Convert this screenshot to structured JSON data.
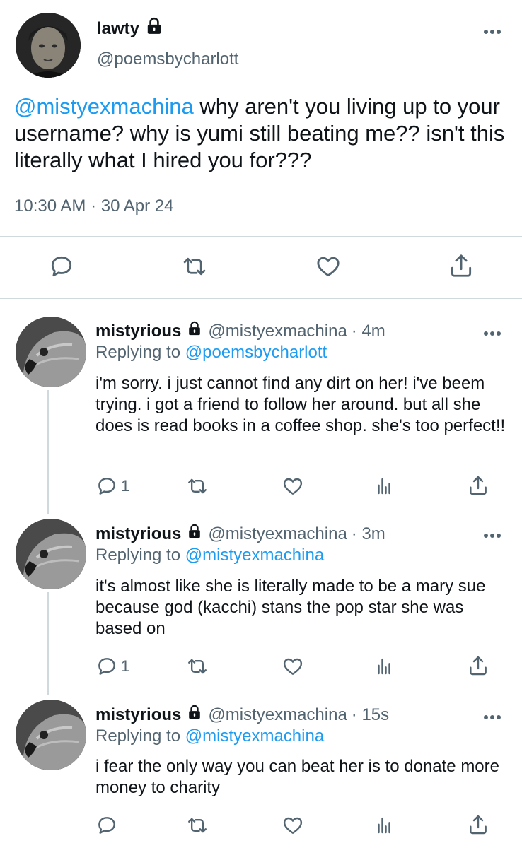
{
  "tweet": {
    "display_name": "lawty",
    "handle": "@poemsbycharlott",
    "mention": "@mistyexmachina",
    "text": " why aren't you living up to your username? why is yumi still beating me?? isn't this literally what I hired you for???",
    "timestamp": "10:30 AM · 30 Apr 24",
    "icons": [
      "reply-icon",
      "retweet-icon",
      "like-icon",
      "share-icon",
      "lock-icon",
      "more-icon"
    ]
  },
  "replies": [
    {
      "display_name": "mistyrious",
      "handle": "@mistyexmachina",
      "time": "· 4m",
      "replying_label": "Replying to ",
      "replying_to": "@poemsbycharlott",
      "text": "i'm sorry. i just cannot find any dirt on her! i've beem trying. i got a friend to follow her around. but all she does is read books in a coffee shop. she's too perfect!!",
      "reply_count": "1"
    },
    {
      "display_name": "mistyrious",
      "handle": "@mistyexmachina",
      "time": "· 3m",
      "replying_label": "Replying to ",
      "replying_to": "@mistyexmachina",
      "text": "it's almost like she is literally made to be a mary sue because god (kacchi) stans the pop star she was based on",
      "reply_count": "1"
    },
    {
      "display_name": "mistyrious",
      "handle": "@mistyexmachina",
      "time": "· 15s",
      "replying_label": "Replying to ",
      "replying_to": "@mistyexmachina",
      "text": "i fear the only way you can beat her is to donate more money to charity",
      "reply_count": ""
    }
  ],
  "colors": {
    "link": "#1d9bf0",
    "muted": "#536471",
    "text": "#0f1419",
    "divider": "#cfd9de"
  }
}
